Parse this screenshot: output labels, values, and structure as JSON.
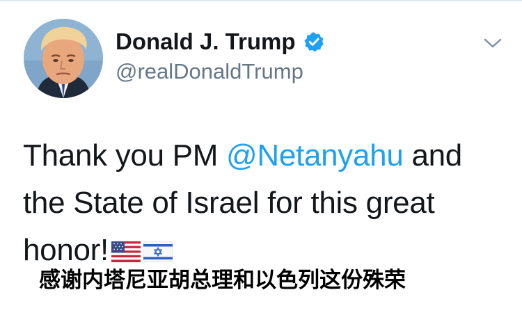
{
  "tweet": {
    "author": {
      "name": "Donald J. Trump",
      "handle": "@realDonaldTrump",
      "verified": true,
      "avatar_icon": "profile-photo"
    },
    "menu_icon": "chevron-down-icon",
    "text": {
      "line1_before": "Thank you PM ",
      "mention": "@Netanyahu",
      "line1_after": " and",
      "line2": "the State of Israel for this great",
      "line3": "honor!",
      "emoji": [
        "us-flag",
        "israel-flag"
      ]
    }
  },
  "caption": "感谢内塔尼亚胡总理和以色列这份殊荣",
  "colors": {
    "link": "#1da1f2",
    "verified_badge": "#1da1f2",
    "handle": "#657786",
    "text": "#14171a",
    "caption": "#000000"
  }
}
